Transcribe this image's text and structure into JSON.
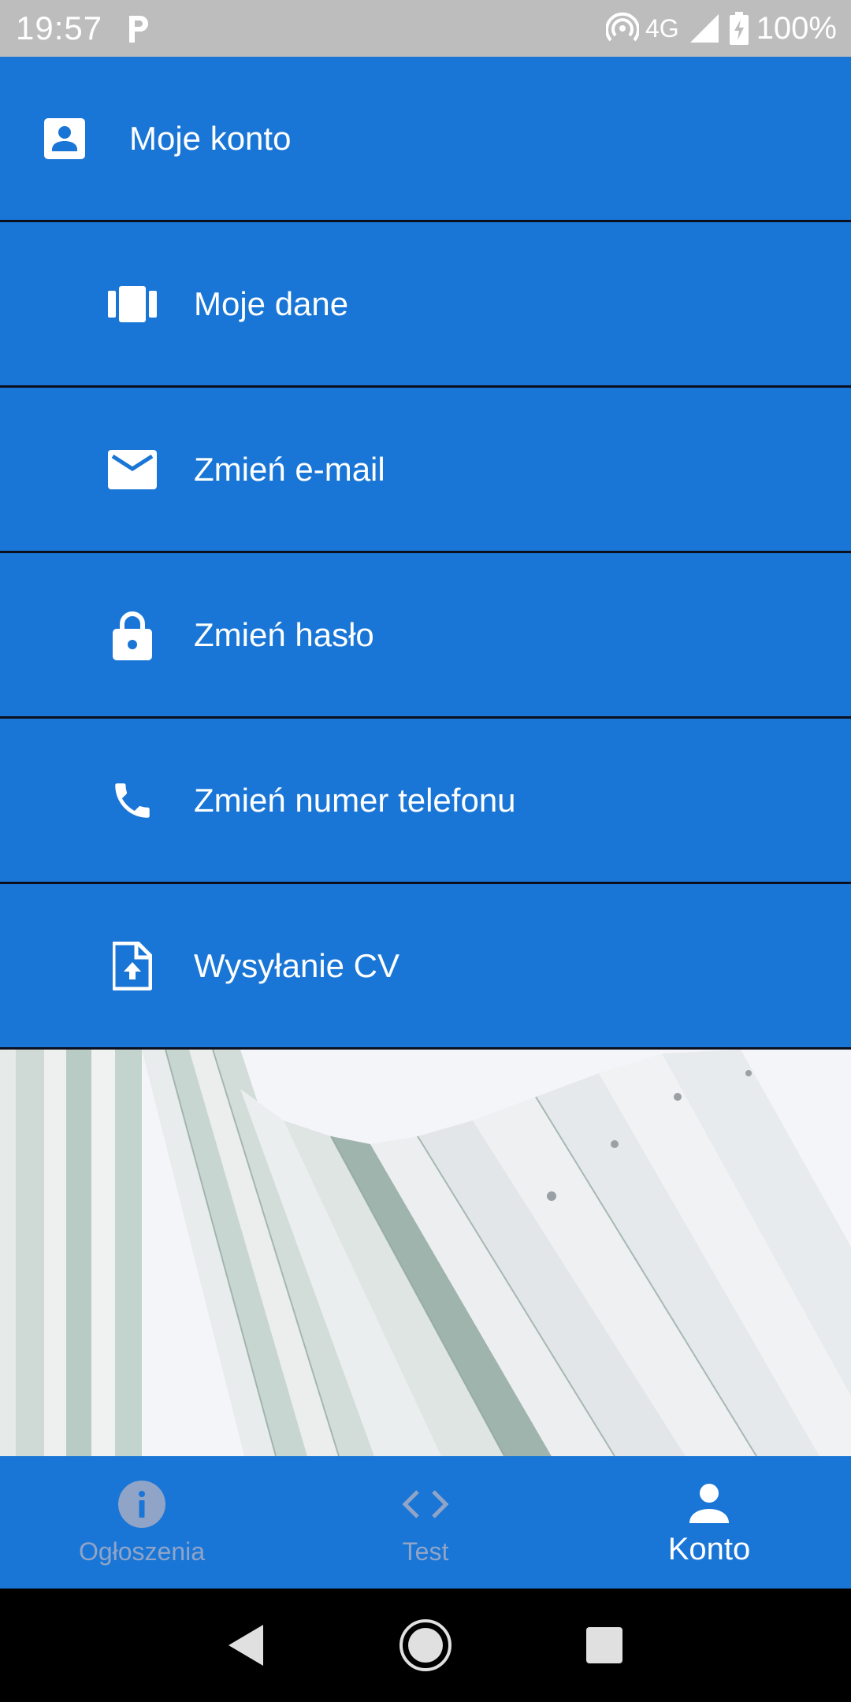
{
  "status_bar": {
    "time": "19:57",
    "network": "4G",
    "battery": "100%"
  },
  "menu": {
    "items": [
      {
        "label": "Moje konto",
        "icon": "account-box-icon"
      },
      {
        "label": "Moje dane",
        "icon": "view-carousel-icon"
      },
      {
        "label": "Zmień e-mail",
        "icon": "mail-icon"
      },
      {
        "label": "Zmień hasło",
        "icon": "lock-icon"
      },
      {
        "label": "Zmień numer telefonu",
        "icon": "phone-icon"
      },
      {
        "label": "Wysyłanie CV",
        "icon": "file-upload-icon"
      }
    ]
  },
  "bottom_nav": {
    "items": [
      {
        "label": "Ogłoszenia",
        "icon": "info-icon",
        "active": false
      },
      {
        "label": "Test",
        "icon": "code-icon",
        "active": false
      },
      {
        "label": "Konto",
        "icon": "person-icon",
        "active": true
      }
    ]
  },
  "colors": {
    "primary": "#1976d6",
    "divider": "#0b0f1e",
    "status_bar": "#bdbdbd",
    "nav_inactive": "#90a4c7"
  }
}
